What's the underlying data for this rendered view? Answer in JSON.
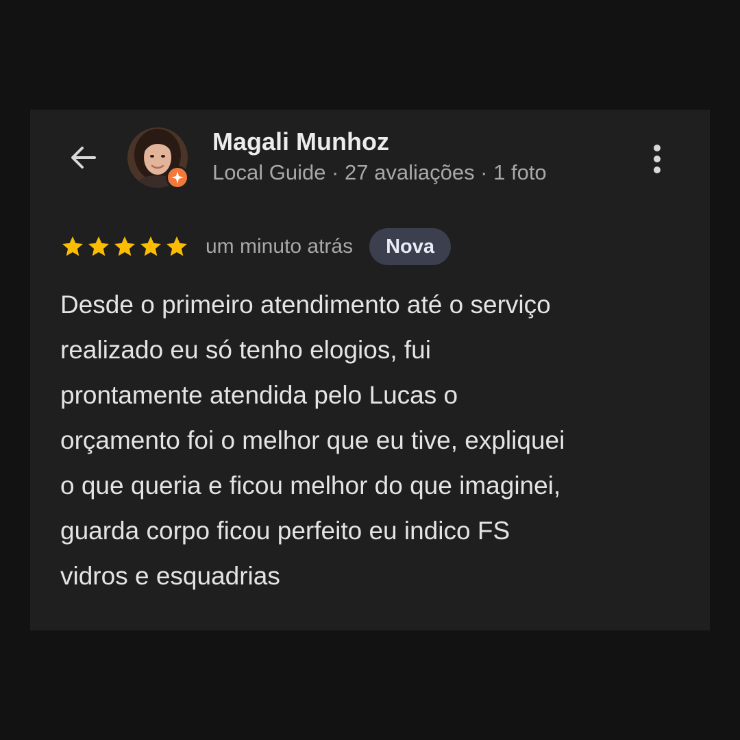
{
  "review": {
    "author": {
      "name": "Magali Munhoz",
      "subtitle": "Local Guide · 27 avaliações · 1 foto",
      "avatar_icon": "avatar-photo",
      "badge_icon": "local-guide-star-icon",
      "badge_color": "#f2793a"
    },
    "header_icons": {
      "back": "arrow-left-icon",
      "menu": "more-vertical-icon"
    },
    "rating": {
      "stars": 5,
      "max_stars": 5,
      "star_color": "#fbbc04"
    },
    "time": "um minuto atrás",
    "badge": "Nova",
    "text": "Desde o primeiro atendimento até o serviço\nrealizado eu só tenho elogios, fui\nprontamente atendida pelo Lucas o\norçamento foi o melhor que eu tive, expliquei\no que queria e ficou melhor do que imaginei,\nguarda corpo ficou perfeito eu indico FS\nvidros e esquadrias"
  }
}
